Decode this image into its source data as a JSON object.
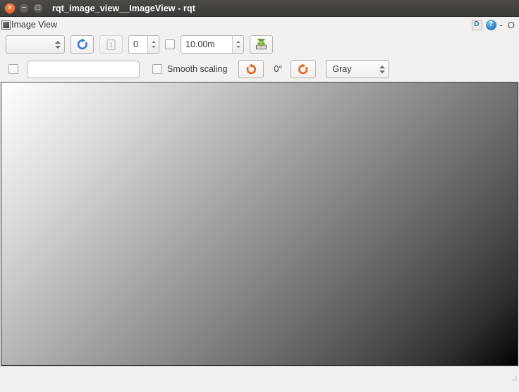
{
  "window": {
    "title": "rqt_image_view__ImageView - rqt",
    "controls": {
      "close": "×",
      "minimize": "−",
      "maximize": "□"
    }
  },
  "plugin_header": {
    "icon": "image-view-icon",
    "title": "Image View",
    "undock_label": "D",
    "help_label": "?",
    "minimize_label": "-",
    "close_label": "O"
  },
  "toolbar_top": {
    "topic_combo": {
      "value": "",
      "placeholder": "",
      "icon": "chevron-updown-icon"
    },
    "refresh_button": {
      "icon": "refresh-icon",
      "label": ""
    },
    "number_of_publishers_button": {
      "icon": "one-in-box-icon",
      "label": "1",
      "enabled": false
    },
    "index_spinbox": {
      "value": "0"
    },
    "dynamic_range_checkbox": {
      "checked": false,
      "label": ""
    },
    "max_range_spinbox": {
      "value": "10.00m"
    },
    "save_button": {
      "icon": "save-image-icon",
      "label": ""
    }
  },
  "toolbar_bottom": {
    "publish_checkbox": {
      "checked": false,
      "label": ""
    },
    "publish_topic_input": {
      "value": "",
      "placeholder": ""
    },
    "smooth_scaling_checkbox": {
      "checked": false,
      "label": "Smooth scaling"
    },
    "rotate_left_button": {
      "icon": "rotate-left-icon",
      "label": ""
    },
    "rotation_label": "0°",
    "rotate_right_button": {
      "icon": "rotate-right-icon",
      "label": ""
    },
    "color_scheme_combo": {
      "value": "Gray",
      "icon": "chevron-updown-icon"
    }
  },
  "image_view": {
    "name": "image-canvas",
    "description": "grayscale diagonal gradient",
    "gradient_from": "#ffffff",
    "gradient_to": "#000000",
    "gradient_direction": "135deg"
  },
  "statusbar": {
    "text": "",
    "grip": "resize-grip"
  },
  "colors": {
    "titlebar_bg": "#3c3b37",
    "chrome_bg": "#f2f1f0",
    "accent_blue": "#3a8ecb",
    "accent_orange": "#e4713c",
    "accent_green": "#8cc63f",
    "text": "#3c3b37"
  }
}
